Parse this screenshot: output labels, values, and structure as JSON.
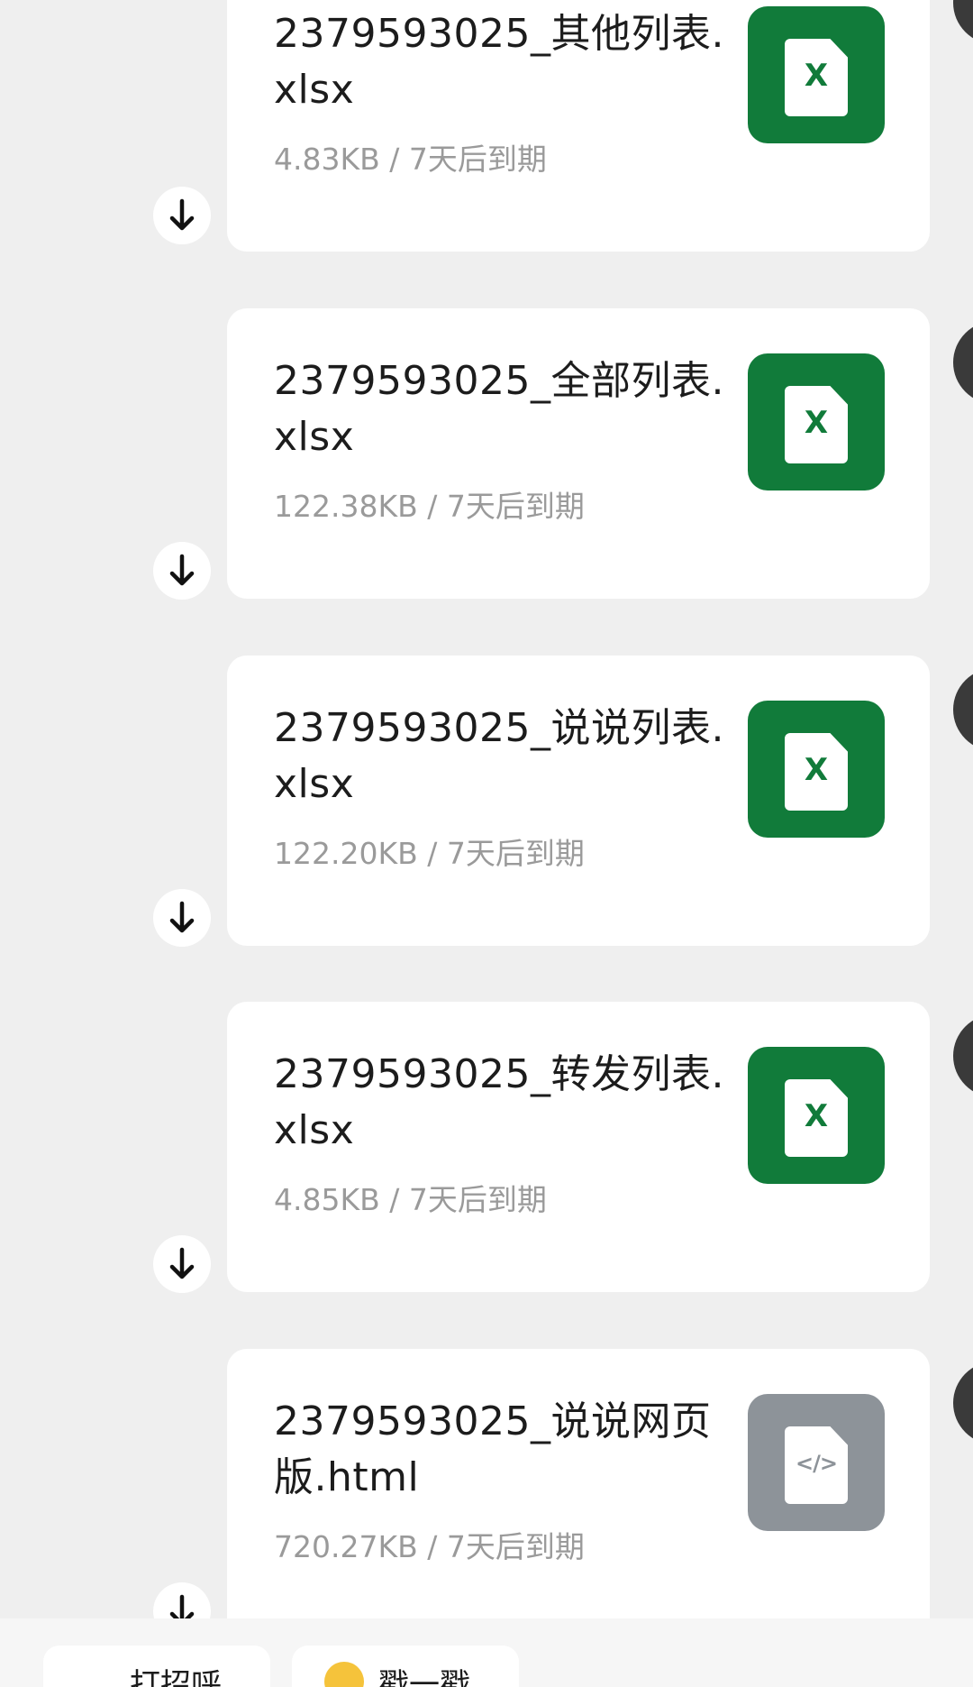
{
  "files": [
    {
      "name": "2379593025_其他列表.xlsx",
      "meta": "4.83KB / 7天后到期",
      "icon": "excel-icon",
      "icon_glyph": "X"
    },
    {
      "name": "2379593025_全部列表.xlsx",
      "meta": "122.38KB / 7天后到期",
      "icon": "excel-icon",
      "icon_glyph": "X"
    },
    {
      "name": "2379593025_说说列表.xlsx",
      "meta": "122.20KB / 7天后到期",
      "icon": "excel-icon",
      "icon_glyph": "X"
    },
    {
      "name": "2379593025_转发列表.xlsx",
      "meta": "4.85KB / 7天后到期",
      "icon": "excel-icon",
      "icon_glyph": "X"
    },
    {
      "name": "2379593025_说说网页版.html",
      "meta": "720.27KB / 7天后到期",
      "icon": "html-code-icon",
      "icon_glyph": "</>"
    }
  ],
  "download_icon": "arrow-down-icon",
  "quick_actions": [
    {
      "label": "打招呼"
    },
    {
      "label": "戳一戳",
      "icon": "smiley-emoji-icon"
    }
  ],
  "colors": {
    "background": "#efefef",
    "excel_green": "#117b3a",
    "html_gray": "#8d9399",
    "meta_text": "#9a9a9a"
  }
}
